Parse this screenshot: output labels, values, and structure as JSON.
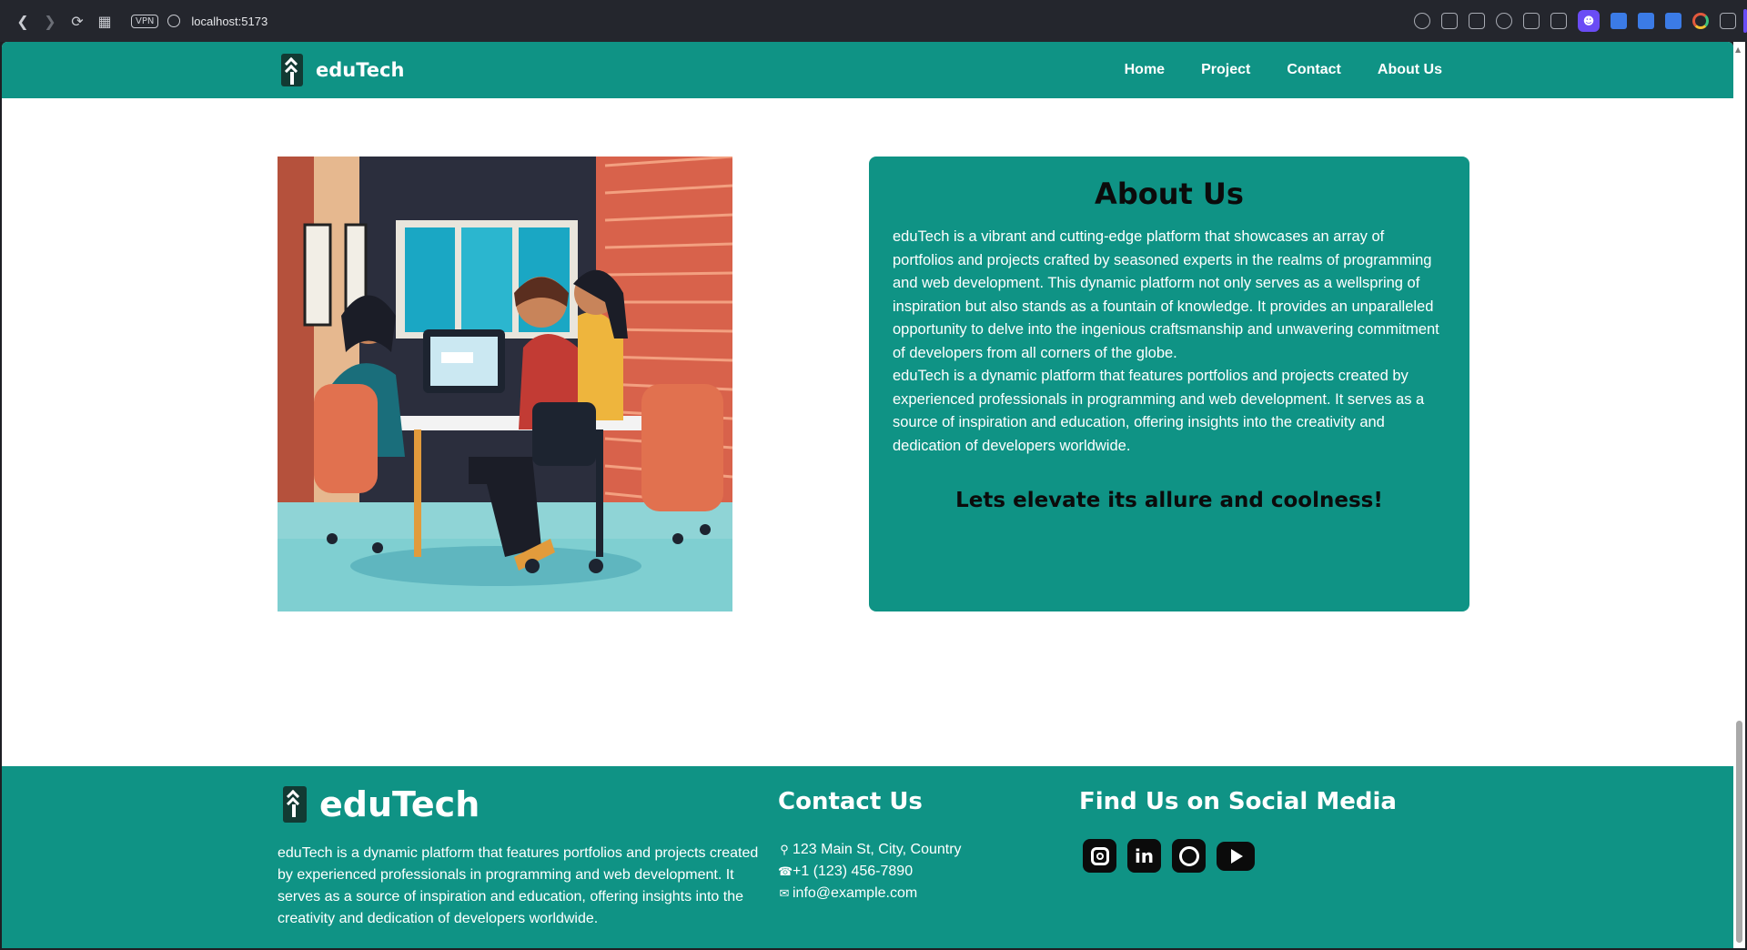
{
  "browser": {
    "url": "localhost:5173",
    "vpn_label": "VPN",
    "back_icon": "back-arrow-icon",
    "forward_icon": "forward-arrow-icon",
    "reload_icon": "reload-icon"
  },
  "navbar": {
    "brand": "eduTech",
    "links": [
      "Home",
      "Project",
      "Contact",
      "About Us"
    ],
    "background_color": "#0f9385"
  },
  "about": {
    "title": "About Us",
    "paragraph1": "eduTech is a vibrant and cutting-edge platform that showcases an array of portfolios and projects crafted by seasoned experts in the realms of programming and web development. This dynamic platform not only serves as a wellspring of inspiration but also stands as a fountain of knowledge. It provides an unparalleled opportunity to delve into the ingenious craftsmanship and unwavering commitment of developers from all corners of the globe.",
    "paragraph2": "eduTech is a dynamic platform that features portfolios and projects created by experienced professionals in programming and web development. It serves as a source of inspiration and education, offering insights into the creativity and dedication of developers worldwide.",
    "cta": "Lets elevate its allure and coolness!"
  },
  "footer": {
    "brand": "eduTech",
    "description": "eduTech is a dynamic platform that features portfolios and projects created by experienced professionals in programming and web development. It serves as a source of inspiration and education, offering insights into the creativity and dedication of developers worldwide.",
    "contact_heading": "Contact Us",
    "address": "123 Main St, City, Country",
    "phone": "+1 (123) 456-7890",
    "email": "info@example.com",
    "social_heading": "Find Us on Social Media",
    "socials": [
      "instagram-icon",
      "linkedin-icon",
      "github-icon",
      "youtube-icon"
    ],
    "linkedin_glyph": "in"
  },
  "colors": {
    "primary": "#0f9385",
    "heading_dark": "#0b0b0b"
  }
}
